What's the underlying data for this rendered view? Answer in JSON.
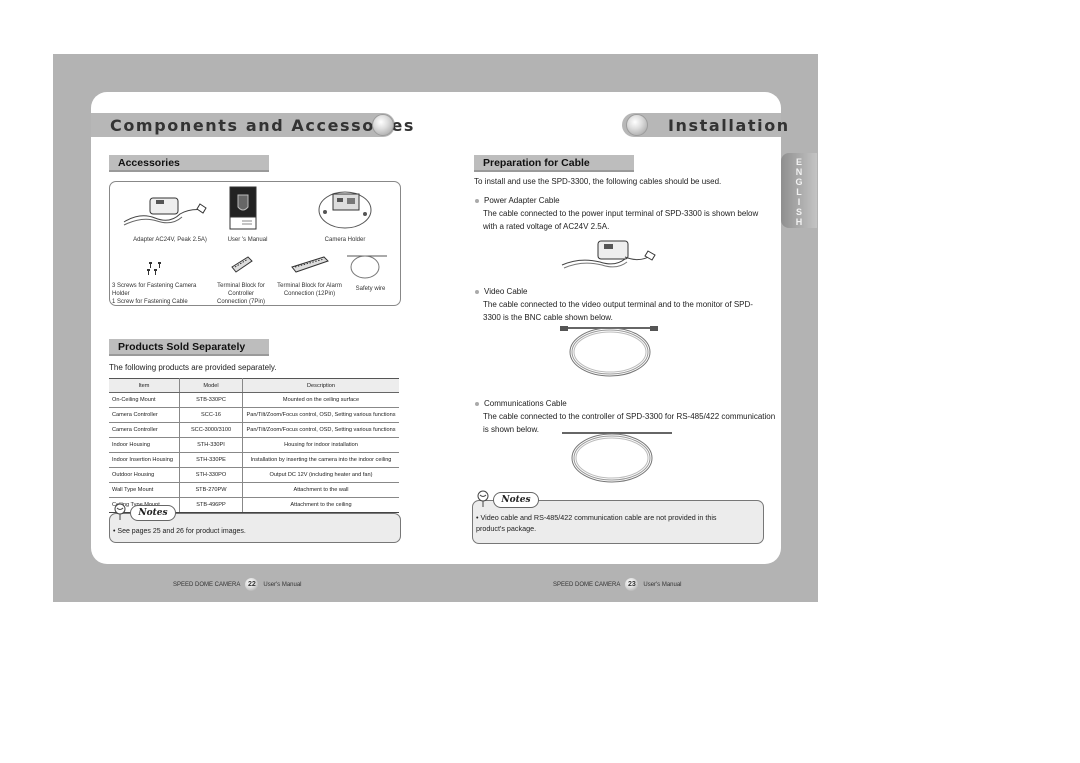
{
  "left_page": {
    "title": "Components and Accessories",
    "accessories": {
      "heading": "Accessories",
      "items": [
        {
          "label": "Adapter AC24V, Peak 2.5A)",
          "icon": "power-adapter-icon"
        },
        {
          "label": "User 's Manual",
          "icon": "manual-icon"
        },
        {
          "label": "Camera Holder",
          "icon": "camera-holder-icon"
        },
        {
          "label_lines": [
            "3 Screws for Fastening Camera Holder",
            "1 Screw for Fastening Cable"
          ],
          "icon": "screws-icon"
        },
        {
          "label_lines": [
            "Terminal Block for Controller",
            "Connection (7Pin)"
          ],
          "icon": "terminal-block-7pin-icon"
        },
        {
          "label_lines": [
            "Terminal Block for Alarm",
            "Connection (12Pin)"
          ],
          "icon": "terminal-block-12pin-icon"
        },
        {
          "label": "Safety wire",
          "icon": "safety-wire-icon"
        }
      ]
    },
    "products": {
      "heading": "Products Sold Separately",
      "intro": "The following products are provided separately.",
      "columns": [
        "Item",
        "Model",
        "Description"
      ],
      "rows": [
        [
          "On-Ceiling Mount",
          "STB-330PC",
          "Mounted on the ceiling surface"
        ],
        [
          "Camera Controller",
          "SCC-16",
          "Pan/Tilt/Zoom/Focus control, OSD, Setting various functions"
        ],
        [
          "Camera Controller",
          "SCC-3000/3100",
          "Pan/Tilt/Zoom/Focus control, OSD, Setting various functions"
        ],
        [
          "Indoor Housing",
          "STH-330PI",
          "Housing for indoor installation"
        ],
        [
          "Indoor Insertion Housing",
          "STH-330PE",
          "Installation by inserting the camera into the indoor ceiling"
        ],
        [
          "Outdoor Housing",
          "STH-330PO",
          "Output DC 12V (including heater and fan)"
        ],
        [
          "Wall Type Mount",
          "STB-270PW",
          "Attachment to the wall"
        ],
        [
          "Ceiling Type Mount",
          "STB-496PP",
          "Attachment to the ceiling"
        ]
      ]
    },
    "notes": {
      "label": "Notes",
      "text": "• See pages 25 and 26 for product images."
    },
    "footer": {
      "product": "SPEED DOME CAMERA",
      "page": "22",
      "suffix": "User's Manual"
    }
  },
  "right_page": {
    "title": "Installation",
    "side_tab": "ENGLISH",
    "preparation": {
      "heading": "Preparation for Cable",
      "intro": "To install and use the SPD-3300, the following cables should be used.",
      "cables": [
        {
          "name": "Power Adapter Cable",
          "desc_lines": [
            "The cable connected to the power input terminal of SPD-3300 is shown below",
            "with a rated voltage of AC24V 2.5A."
          ]
        },
        {
          "name": "Video Cable",
          "desc_lines": [
            "The cable connected to the video output terminal and to the monitor of SPD-",
            "3300 is the BNC cable shown below."
          ]
        },
        {
          "name": "Communications Cable",
          "desc_lines": [
            "The cable connected to the controller of SPD-3300 for RS-485/422 communication",
            "is shown below."
          ]
        }
      ]
    },
    "notes": {
      "label": "Notes",
      "text_lines": [
        "• Video cable and RS-485/422 communication cable are not provided in this",
        "product's package."
      ]
    },
    "footer": {
      "product": "SPEED DOME CAMERA",
      "page": "23",
      "suffix": "User's Manual"
    }
  }
}
